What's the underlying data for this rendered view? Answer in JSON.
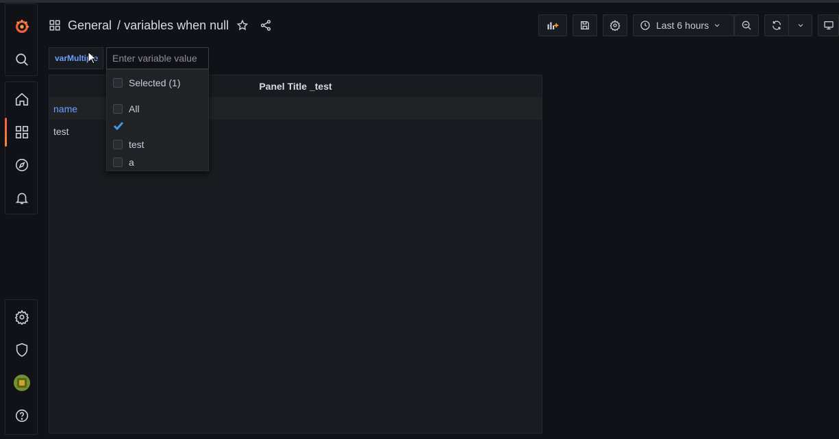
{
  "header": {
    "breadcrumb_folder": "General",
    "breadcrumb_separator": "/",
    "dashboard_title": "variables when null"
  },
  "toolbar": {
    "time_range": "Last 6 hours"
  },
  "variable": {
    "label": "varMultiple",
    "input_placeholder": "Enter variable value",
    "options": [
      {
        "label": "Selected (1)",
        "checked": false
      },
      {
        "label": "All",
        "checked": false
      },
      {
        "label": "",
        "checked": true
      },
      {
        "label": "test",
        "checked": false
      },
      {
        "label": "a",
        "checked": false
      }
    ]
  },
  "panel": {
    "title": "Panel Title _test",
    "table": {
      "columns": [
        "name"
      ],
      "rows": [
        [
          "test"
        ]
      ]
    }
  },
  "colors": {
    "accent_orange": "#f55f3e",
    "link_blue": "#6e9fff",
    "check_blue": "#3d9be9",
    "background": "#111217",
    "panel": "#181b1f"
  },
  "icons": {
    "sidebar_top": [
      "grafana-logo-icon",
      "search-icon"
    ],
    "sidebar_nav": [
      "home-icon",
      "dashboards-icon",
      "explore-icon",
      "alerting-icon"
    ],
    "sidebar_bottom": [
      "gear-icon",
      "shield-icon",
      "avatar",
      "help-icon"
    ]
  }
}
